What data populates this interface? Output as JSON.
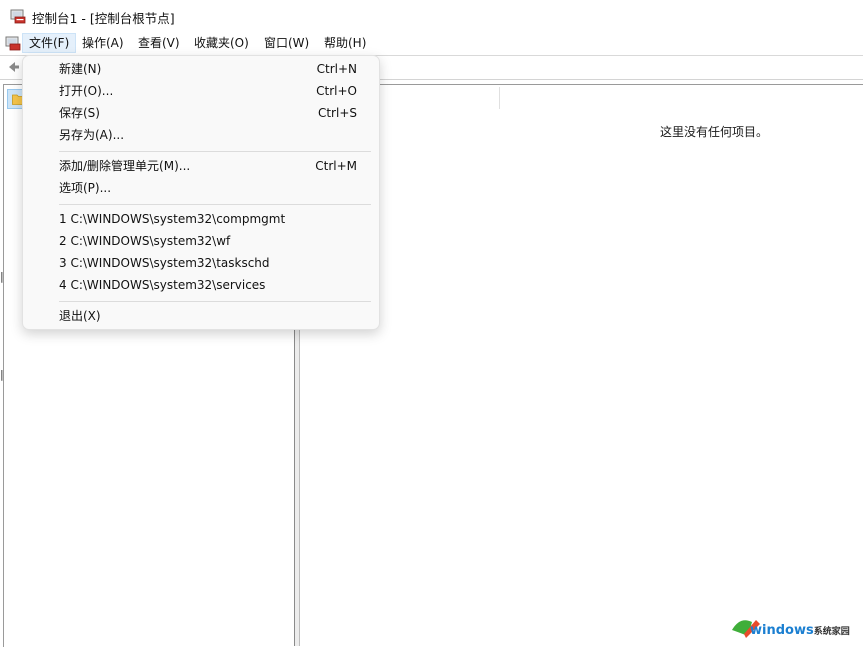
{
  "window": {
    "title": "控制台1 - [控制台根节点]",
    "app_icon": "mmc-console-icon"
  },
  "menubar": {
    "items": [
      {
        "label": "文件(F)",
        "active": true
      },
      {
        "label": "操作(A)"
      },
      {
        "label": "查看(V)"
      },
      {
        "label": "收藏夹(O)"
      },
      {
        "label": "窗口(W)"
      },
      {
        "label": "帮助(H)"
      }
    ]
  },
  "file_menu": {
    "items": [
      {
        "label": "新建(N)",
        "shortcut": "Ctrl+N"
      },
      {
        "label": "打开(O)...",
        "shortcut": "Ctrl+O"
      },
      {
        "label": "保存(S)",
        "shortcut": "Ctrl+S"
      },
      {
        "label": "另存为(A)...",
        "shortcut": ""
      },
      {
        "label": "添加/删除管理单元(M)...",
        "shortcut": "Ctrl+M"
      },
      {
        "label": "选项(P)...",
        "shortcut": ""
      },
      {
        "label": "1 C:\\WINDOWS\\system32\\compmgmt",
        "shortcut": ""
      },
      {
        "label": "2 C:\\WINDOWS\\system32\\wf",
        "shortcut": ""
      },
      {
        "label": "3 C:\\WINDOWS\\system32\\taskschd",
        "shortcut": ""
      },
      {
        "label": "4 C:\\WINDOWS\\system32\\services",
        "shortcut": ""
      },
      {
        "label": "退出(X)",
        "shortcut": ""
      }
    ]
  },
  "right_pane": {
    "empty_message": "这里没有任何项目。"
  },
  "watermark": {
    "brand": "windows",
    "suffix": "系统家园",
    "brand_color": "#1b7fd1"
  },
  "colors": {
    "menu_active_bg": "#e5f0fb",
    "tree_selected_bg": "#cce4f7"
  }
}
